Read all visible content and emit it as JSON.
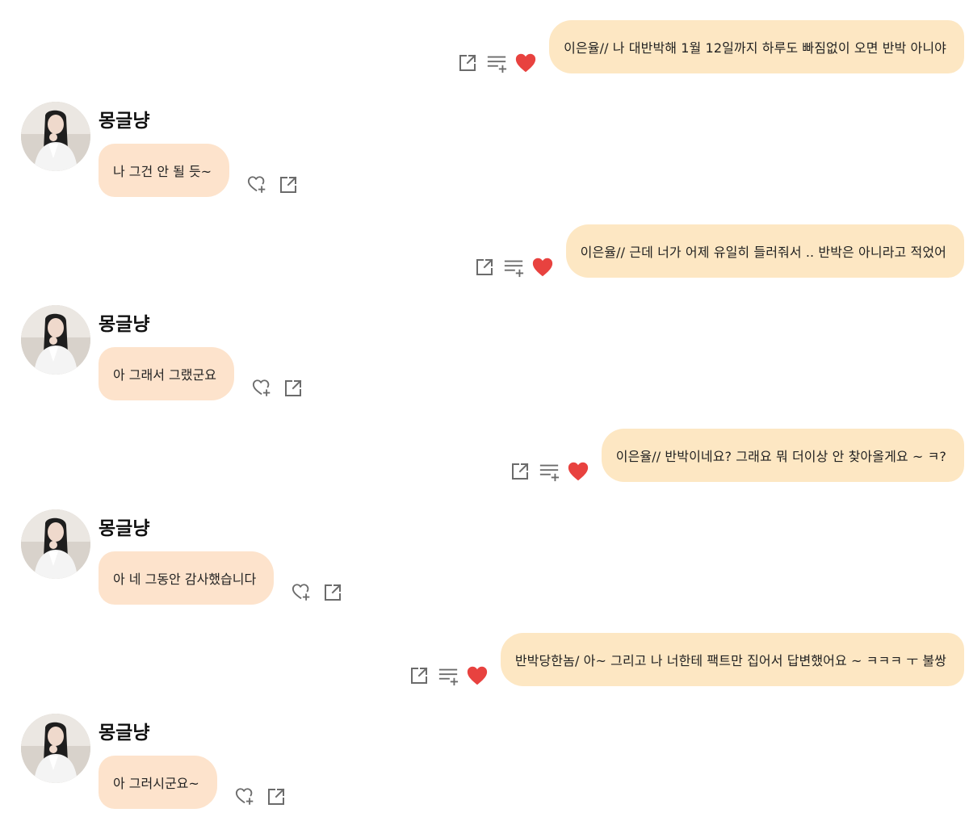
{
  "colors": {
    "outgoing_bubble": "#fde7c3",
    "incoming_bubble": "#fde3cc",
    "heart": "#e8423f",
    "icon_gray": "#6b6b6b"
  },
  "icons": {
    "out_actions": [
      "share-icon",
      "add-to-list-icon",
      "heart-icon"
    ],
    "in_actions": [
      "heart-plus-icon",
      "share-icon"
    ]
  },
  "messages": [
    {
      "type": "out",
      "text": "이은율// 나 대반박해 1월 12일까지 하루도 빠짐없이 오면 반박 아니야"
    },
    {
      "type": "in",
      "sender": "몽글냥",
      "text": "나 그건 안 될 듯~"
    },
    {
      "type": "out",
      "text": "이은율// 근데 너가 어제 유일히 들러줘서 .. 반박은 아니라고 적었어"
    },
    {
      "type": "in",
      "sender": "몽글냥",
      "text": "아 그래서 그랬군요"
    },
    {
      "type": "out",
      "text": "이은율// 반박이네요? 그래요 뭐 더이상 안 찾아올게요 ~ ㅋ?"
    },
    {
      "type": "in",
      "sender": "몽글냥",
      "text": "아 네 그동안 감사했습니다"
    },
    {
      "type": "out",
      "text": "반박당한놈/ 아~ 그리고 나 너한테 팩트만 집어서 답변했어요 ~ ㅋㅋㅋ ㅜ 불쌍"
    },
    {
      "type": "in",
      "sender": "몽글냥",
      "text": "아 그러시군요~"
    }
  ]
}
